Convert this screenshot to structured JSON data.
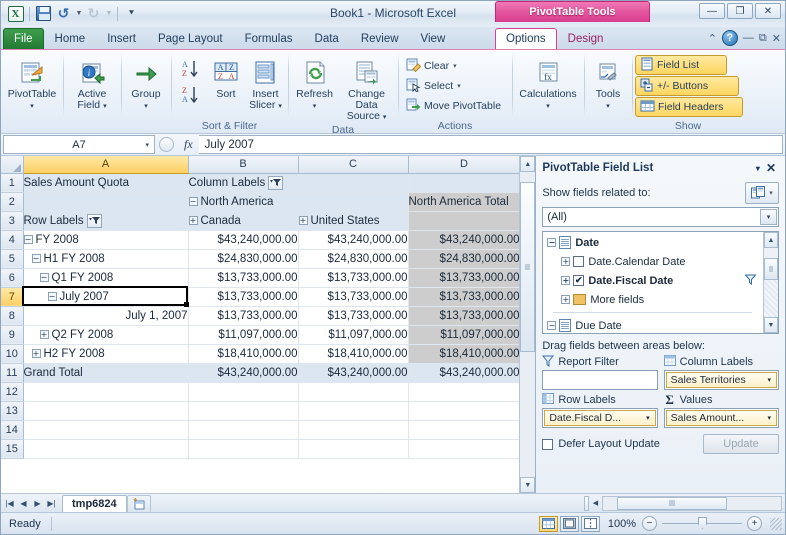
{
  "window": {
    "title": "Book1  -  Microsoft Excel",
    "contextual_tab_banner": "PivotTable Tools",
    "minimize": "—",
    "restore": "❐",
    "close": "✕"
  },
  "quick_access": {
    "logo": "excel-logo-icon",
    "save": "save-icon",
    "undo": "undo-icon",
    "redo": "redo-icon",
    "customize": "customize-qat-icon"
  },
  "tabs": [
    {
      "label": "File",
      "type": "file"
    },
    {
      "label": "Home",
      "type": "normal"
    },
    {
      "label": "Insert",
      "type": "normal"
    },
    {
      "label": "Page Layout",
      "type": "normal"
    },
    {
      "label": "Formulas",
      "type": "normal"
    },
    {
      "label": "Data",
      "type": "normal"
    },
    {
      "label": "Review",
      "type": "normal"
    },
    {
      "label": "View",
      "type": "normal"
    }
  ],
  "contextual_tabs": [
    {
      "label": "Options",
      "active": true
    },
    {
      "label": "Design",
      "active": false
    }
  ],
  "ribbon": {
    "groups": [
      {
        "name": "PivotTable",
        "label": "",
        "buttons": [
          {
            "label": "PivotTable",
            "caret": "▾",
            "icon": "pivottable-icon"
          }
        ]
      },
      {
        "name": "ActiveField",
        "label": "",
        "buttons": [
          {
            "label": "Active",
            "label2": "Field",
            "caret": "▾",
            "icon": "active-field-icon"
          }
        ]
      },
      {
        "name": "Group",
        "label": "",
        "buttons": [
          {
            "label": "Group",
            "caret": "▾",
            "icon": "group-icon"
          }
        ]
      },
      {
        "name": "SortFilter",
        "label": "Sort & Filter",
        "buttons": [
          {
            "label": "Sort",
            "icon": "sort-az-icon"
          },
          {
            "label": "Insert",
            "label2": "Slicer",
            "caret": "▾",
            "icon": "insert-slicer-icon"
          }
        ]
      },
      {
        "name": "Data",
        "label": "Data",
        "buttons": [
          {
            "label": "Refresh",
            "caret": "▾",
            "icon": "refresh-icon"
          },
          {
            "label": "Change Data",
            "label2": "Source",
            "caret": "▾",
            "icon": "change-data-source-icon"
          }
        ]
      },
      {
        "name": "Actions",
        "label": "Actions",
        "small_buttons": [
          {
            "label": "Clear",
            "caret": "▾",
            "icon": "clear-icon"
          },
          {
            "label": "Select",
            "caret": "▾",
            "icon": "select-icon"
          },
          {
            "label": "Move PivotTable",
            "caret": "",
            "icon": "move-pivottable-icon"
          }
        ]
      },
      {
        "name": "Calculations",
        "label": "",
        "buttons": [
          {
            "label": "Calculations",
            "caret": "▾",
            "icon": "calculations-icon"
          }
        ]
      },
      {
        "name": "Tools",
        "label": "",
        "buttons": [
          {
            "label": "Tools",
            "caret": "▾",
            "icon": "tools-icon"
          }
        ]
      },
      {
        "name": "Show",
        "label": "Show",
        "toggles": [
          {
            "label": "Field List",
            "icon": "field-list-icon",
            "pressed": true
          },
          {
            "label": "+/- Buttons",
            "icon": "plus-minus-buttons-icon",
            "pressed": true
          },
          {
            "label": "Field Headers",
            "icon": "field-headers-icon",
            "pressed": true
          }
        ]
      }
    ],
    "help_icons": {
      "collapse": "collapse-ribbon-icon",
      "help": "?",
      "win_minimize": "—",
      "win_restore": "❐",
      "win_close": "✕"
    }
  },
  "formula_bar": {
    "name_box": "A7",
    "name_box_caret": "▾",
    "fx_label": "fx",
    "formula_value": "July 2007"
  },
  "grid": {
    "column_headers": [
      "A",
      "B",
      "C",
      "D"
    ],
    "selected_column": "A",
    "row_numbers": [
      "1",
      "2",
      "3",
      "4",
      "5",
      "6",
      "7",
      "8",
      "9",
      "10",
      "11",
      "12",
      "13",
      "14",
      "15"
    ],
    "selected_row": "7",
    "selected_cell": "A7",
    "rows": [
      {
        "num": "1",
        "cells": [
          {
            "text": "Sales Amount Quota",
            "style": "pv-hdr",
            "indent": 0
          },
          {
            "text": "Column Labels",
            "style": "pv-hdr",
            "filter": true,
            "indent": 0
          },
          {
            "text": "",
            "style": "pv"
          },
          {
            "text": "",
            "style": "pv"
          }
        ]
      },
      {
        "num": "2",
        "cells": [
          {
            "text": "",
            "style": "pv"
          },
          {
            "text": "North America",
            "style": "pv-hdr",
            "expander": "−",
            "indent": 0
          },
          {
            "text": "",
            "style": "pv"
          },
          {
            "text": "North America Total",
            "style": "pv-total-col b",
            "indent": 0
          }
        ]
      },
      {
        "num": "3",
        "cells": [
          {
            "text": "Row Labels",
            "style": "pv-hdr",
            "filter": true,
            "indent": 0
          },
          {
            "text": "Canada",
            "style": "pv-hdr",
            "expander": "+",
            "indent": 0
          },
          {
            "text": "United States",
            "style": "pv-hdr",
            "expander": "+",
            "indent": 0
          },
          {
            "text": "",
            "style": "pv-total-col"
          }
        ]
      },
      {
        "num": "4",
        "cells": [
          {
            "text": "FY 2008",
            "style": "pv-white b",
            "expander": "−",
            "indent": 0
          },
          {
            "text": "$43,240,000.00",
            "style": "pv-white b num"
          },
          {
            "text": "$43,240,000.00",
            "style": "pv-white b num"
          },
          {
            "text": "$43,240,000.00",
            "style": "pv-total-col b num"
          }
        ]
      },
      {
        "num": "5",
        "cells": [
          {
            "text": "H1 FY 2008",
            "style": "pv-white b",
            "expander": "−",
            "indent": 1
          },
          {
            "text": "$24,830,000.00",
            "style": "pv-white b num"
          },
          {
            "text": "$24,830,000.00",
            "style": "pv-white b num"
          },
          {
            "text": "$24,830,000.00",
            "style": "pv-total-col b num"
          }
        ]
      },
      {
        "num": "6",
        "cells": [
          {
            "text": "Q1 FY 2008",
            "style": "pv-white",
            "expander": "−",
            "indent": 2
          },
          {
            "text": "$13,733,000.00",
            "style": "pv-white num"
          },
          {
            "text": "$13,733,000.00",
            "style": "pv-white num"
          },
          {
            "text": "$13,733,000.00",
            "style": "pv-total-col num"
          }
        ]
      },
      {
        "num": "7",
        "cells": [
          {
            "text": "July 2007",
            "style": "pv-white b",
            "expander": "−",
            "indent": 3
          },
          {
            "text": "$13,733,000.00",
            "style": "pv-white b num"
          },
          {
            "text": "$13,733,000.00",
            "style": "pv-white b num"
          },
          {
            "text": "$13,733,000.00",
            "style": "pv-total-col b num"
          }
        ]
      },
      {
        "num": "8",
        "cells": [
          {
            "text": "July 1, 2007",
            "style": "pv-white num",
            "indent": 0
          },
          {
            "text": "$13,733,000.00",
            "style": "pv-white num"
          },
          {
            "text": "$13,733,000.00",
            "style": "pv-white num"
          },
          {
            "text": "$13,733,000.00",
            "style": "pv-total-col num"
          }
        ]
      },
      {
        "num": "9",
        "cells": [
          {
            "text": "Q2 FY 2008",
            "style": "pv-white",
            "expander": "+",
            "indent": 2
          },
          {
            "text": "$11,097,000.00",
            "style": "pv-white num"
          },
          {
            "text": "$11,097,000.00",
            "style": "pv-white num"
          },
          {
            "text": "$11,097,000.00",
            "style": "pv-total-col num"
          }
        ]
      },
      {
        "num": "10",
        "cells": [
          {
            "text": "H2 FY 2008",
            "style": "pv-white b",
            "expander": "+",
            "indent": 1
          },
          {
            "text": "$18,410,000.00",
            "style": "pv-white b num"
          },
          {
            "text": "$18,410,000.00",
            "style": "pv-white b num"
          },
          {
            "text": "$18,410,000.00",
            "style": "pv-total-col b num"
          }
        ]
      },
      {
        "num": "11",
        "cells": [
          {
            "text": "Grand Total",
            "style": "pv-total-row",
            "indent": 0
          },
          {
            "text": "$43,240,000.00",
            "style": "pv-total-row num"
          },
          {
            "text": "$43,240,000.00",
            "style": "pv-total-row num"
          },
          {
            "text": "$43,240,000.00",
            "style": "pv-total-row num"
          }
        ]
      },
      {
        "num": "12",
        "cells": [
          {
            "text": "",
            "style": "pv-white"
          },
          {
            "text": "",
            "style": "pv-white"
          },
          {
            "text": "",
            "style": "pv-white"
          },
          {
            "text": "",
            "style": "pv-white"
          }
        ]
      },
      {
        "num": "13",
        "cells": [
          {
            "text": "",
            "style": "pv-white"
          },
          {
            "text": "",
            "style": "pv-white"
          },
          {
            "text": "",
            "style": "pv-white"
          },
          {
            "text": "",
            "style": "pv-white"
          }
        ]
      },
      {
        "num": "14",
        "cells": [
          {
            "text": "",
            "style": "pv-white"
          },
          {
            "text": "",
            "style": "pv-white"
          },
          {
            "text": "",
            "style": "pv-white"
          },
          {
            "text": "",
            "style": "pv-white"
          }
        ]
      },
      {
        "num": "15",
        "cells": [
          {
            "text": "",
            "style": "pv-white"
          },
          {
            "text": "",
            "style": "pv-white"
          },
          {
            "text": "",
            "style": "pv-white"
          },
          {
            "text": "",
            "style": "pv-white"
          }
        ]
      }
    ]
  },
  "field_list": {
    "title": "PivotTable Field List",
    "minimize_caret": "▾",
    "close": "✕",
    "show_fields_label": "Show fields related to:",
    "related_button_icon": "related-tables-icon",
    "related_button_caret": "▾",
    "scope_value": "(All)",
    "scope_caret": "▾",
    "tree": [
      {
        "label": "Date",
        "level": 0,
        "expander": "−",
        "icon": "table-icon",
        "bold": true,
        "checkbox": null
      },
      {
        "label": "Date.Calendar Date",
        "level": 1,
        "expander": "+",
        "icon": null,
        "bold": false,
        "checkbox": "unchecked"
      },
      {
        "label": "Date.Fiscal Date",
        "level": 1,
        "expander": "+",
        "icon": null,
        "bold": true,
        "checkbox": "checked",
        "filter_icon": "funnel-icon"
      },
      {
        "label": "More fields",
        "level": 1,
        "expander": "+",
        "icon": "folder-icon",
        "bold": false,
        "checkbox": null
      },
      {
        "label": "Due Date",
        "level": 0,
        "expander": "−",
        "icon": "table-icon",
        "bold": false,
        "checkbox": null
      }
    ],
    "drag_label": "Drag fields between areas below:",
    "areas": [
      {
        "name": "report-filter",
        "header": "Report Filter",
        "icon": "funnel-icon",
        "pill": null
      },
      {
        "name": "column-labels",
        "header": "Column Labels",
        "icon": "grid-icon",
        "pill": "Sales Territories",
        "pill_caret": "▾"
      },
      {
        "name": "row-labels",
        "header": "Row Labels",
        "icon": "grid-icon",
        "pill": "Date.Fiscal D...",
        "pill_caret": "▾"
      },
      {
        "name": "values",
        "header": "Values",
        "icon": "sigma-icon",
        "icon_text": "Σ",
        "pill": "Sales Amount...",
        "pill_caret": "▾"
      }
    ],
    "defer_label": "Defer Layout Update",
    "defer_checked": false,
    "update_button": "Update"
  },
  "sheet_tabs": {
    "nav_first": "|◀",
    "nav_prev": "◀",
    "nav_next": "▶",
    "nav_last": "▶|",
    "tabs": [
      {
        "label": "tmp6824",
        "active": true
      }
    ],
    "new_sheet_icon": "insert-worksheet-icon"
  },
  "status_bar": {
    "status": "Ready",
    "view_buttons": [
      {
        "name": "normal-view-button",
        "icon": "normal-view-icon",
        "active": true
      },
      {
        "name": "page-layout-view-button",
        "icon": "page-layout-view-icon",
        "active": false
      },
      {
        "name": "page-break-preview-button",
        "icon": "page-break-preview-icon",
        "active": false
      }
    ],
    "zoom_label": "100%",
    "zoom_out": "−",
    "zoom_in": "+"
  }
}
